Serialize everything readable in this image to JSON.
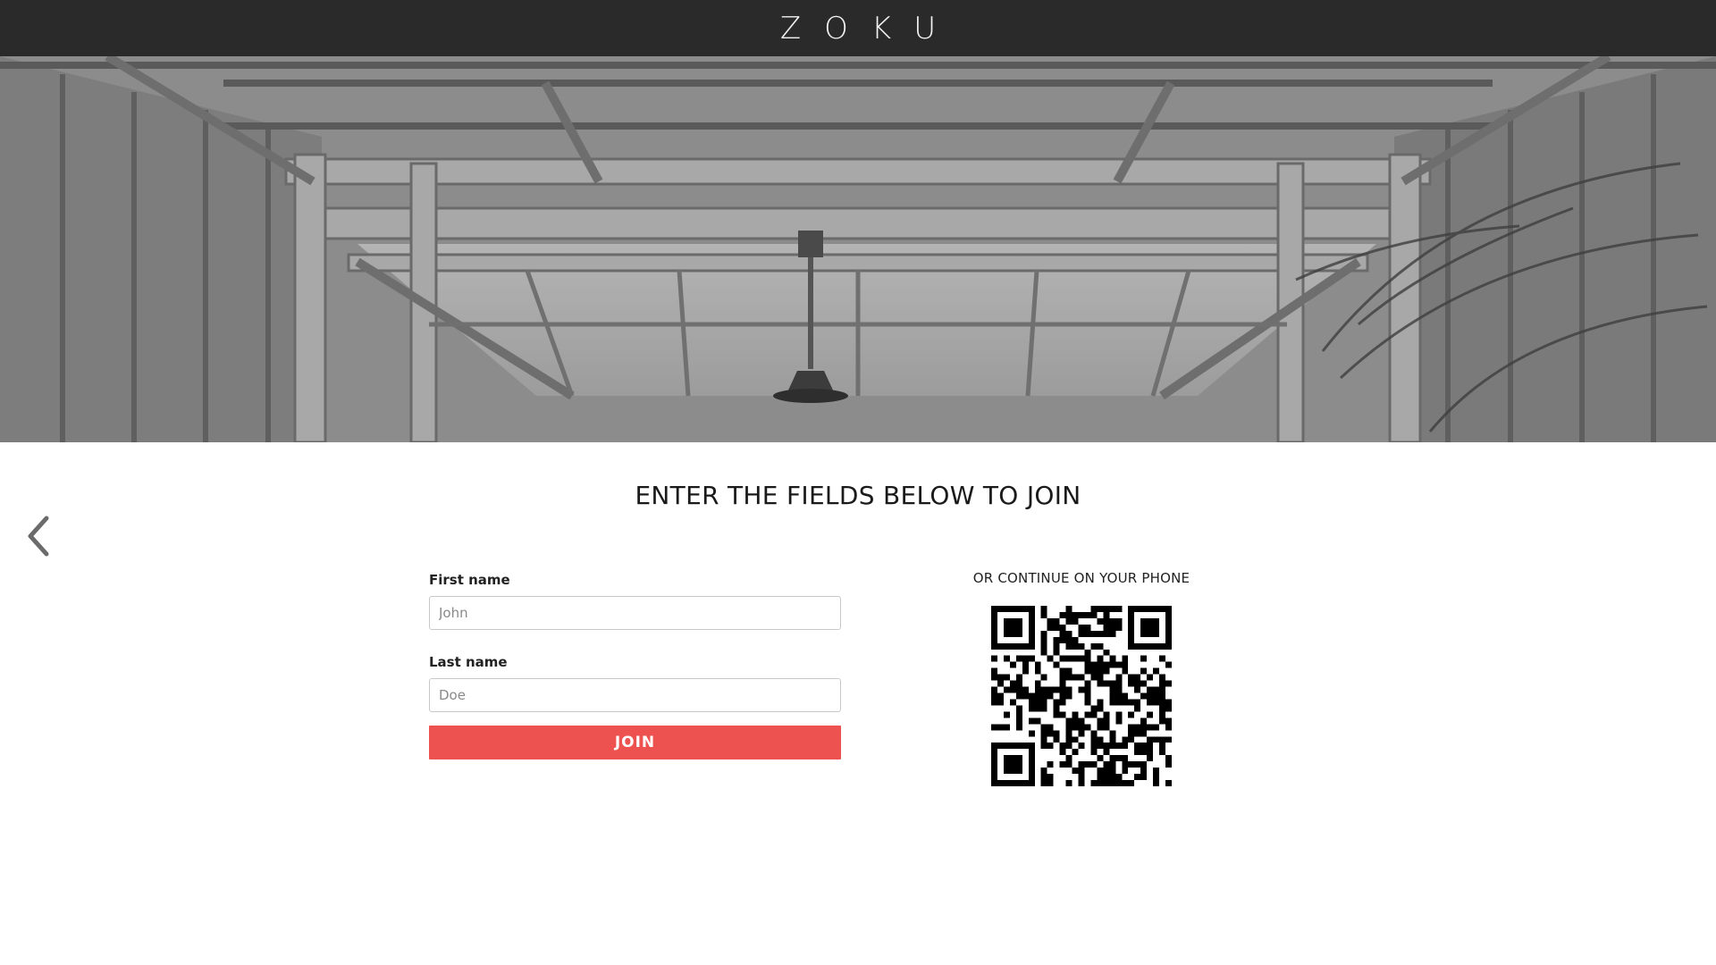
{
  "header": {
    "logo_text": "ZOKU"
  },
  "hero": {
    "image_description_icon": "greenhouse-ceiling-photo"
  },
  "navigation": {
    "back_icon": "chevron-left-icon"
  },
  "main": {
    "title": "ENTER THE FIELDS BELOW TO JOIN"
  },
  "form": {
    "first_name": {
      "label": "First name",
      "placeholder": "John",
      "value": ""
    },
    "last_name": {
      "label": "Last name",
      "placeholder": "Doe",
      "value": ""
    },
    "submit_label": "JOIN"
  },
  "phone": {
    "label": "OR CONTINUE ON YOUR PHONE",
    "qr_icon": "qr-code-icon"
  },
  "colors": {
    "topbar": "#2a2a2a",
    "join_button": "#ee5250",
    "text": "#1a1a1a"
  }
}
